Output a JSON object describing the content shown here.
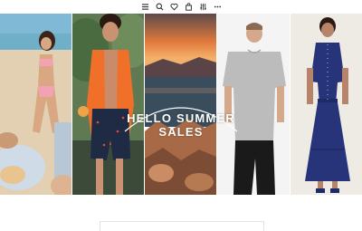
{
  "toolbar": {
    "icons": [
      "menu-icon",
      "search-icon",
      "heart-icon",
      "bag-icon",
      "filter-icon",
      "more-icon"
    ]
  },
  "banner": {
    "headline_line1": "HELLO SUMMER",
    "headline_line2": "SALES"
  },
  "panels": [
    {
      "subject": "beach-photo"
    },
    {
      "subject": "man-orange-shirt-photo"
    },
    {
      "subject": "coastal-sunset-photo"
    },
    {
      "subject": "man-grey-tshirt-photo"
    },
    {
      "subject": "woman-blue-dress-photo"
    }
  ],
  "colors": {
    "accent_orange": "#f0702a",
    "dress_navy": "#27347a",
    "tshirt_grey": "#bcbcbc"
  }
}
